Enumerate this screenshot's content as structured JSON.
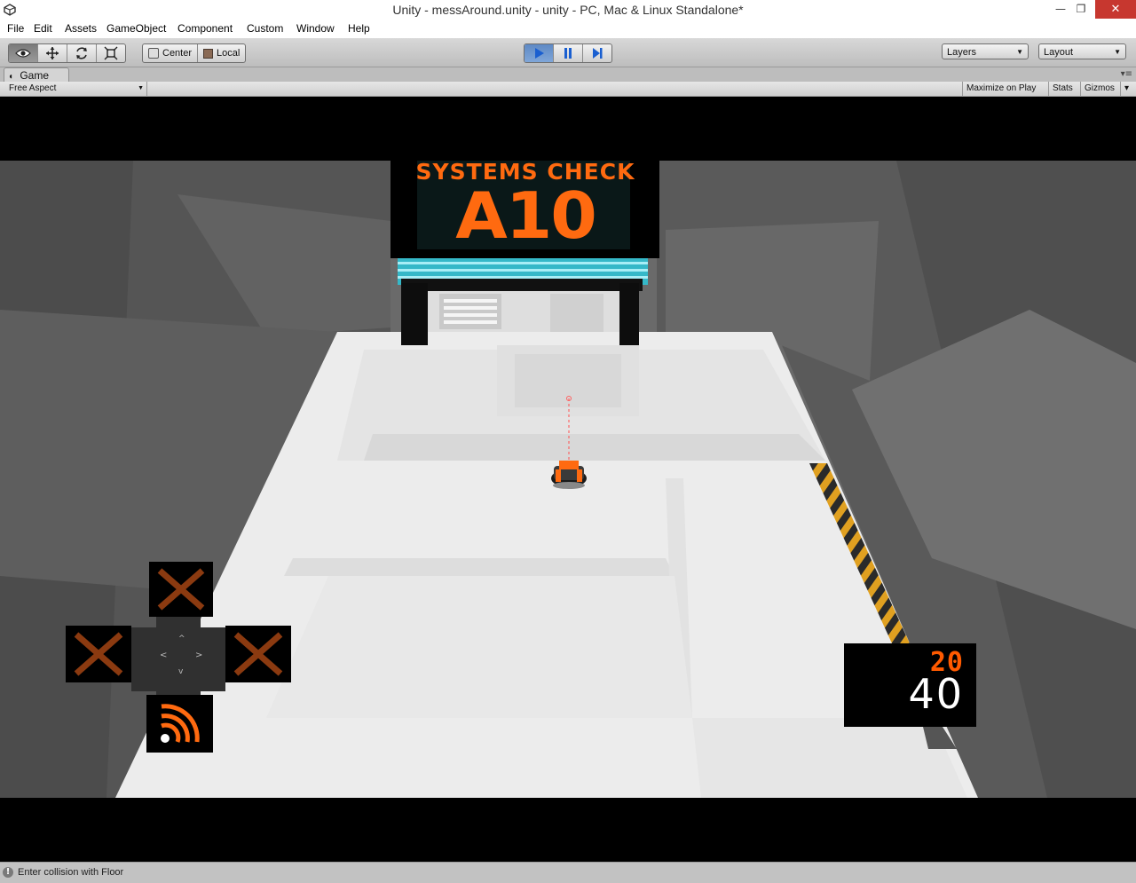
{
  "window": {
    "title": "Unity - messAround.unity - unity - PC, Mac & Linux Standalone*",
    "minimize_glyph": "—",
    "maximize_glyph": "❐",
    "close_glyph": "✕"
  },
  "menu": {
    "items": [
      "File",
      "Edit",
      "Assets",
      "GameObject",
      "Component",
      "Custom",
      "Window",
      "Help"
    ]
  },
  "toolbar": {
    "tools": [
      "view-tool",
      "move-tool",
      "rotate-tool",
      "scale-tool"
    ],
    "active_tool": "view-tool",
    "pivot_mode_label": "Center",
    "pivot_rotation_label": "Local",
    "layers_label": "Layers",
    "layout_label": "Layout",
    "play_state": "playing"
  },
  "game_tab": {
    "label": "Game",
    "aspect_label": "Free Aspect",
    "maximize_on_play_label": "Maximize on Play",
    "stats_label": "Stats",
    "gizmos_label": "Gizmos"
  },
  "game_view": {
    "sign_title": "SYSTEMS CHECK",
    "sign_code": "A10",
    "score_small": "20",
    "score_large": "40",
    "colors": {
      "accent_orange": "#ff6a10",
      "floor": "#ececec",
      "wall": "#5a5a5a",
      "teal": "#35b8c8",
      "hazard_yellow": "#e0a020"
    },
    "dpad_slot_icons": [
      "x-icon",
      "x-icon",
      "x-icon",
      "signal-icon"
    ]
  },
  "status": {
    "message": "Enter collision with Floor"
  }
}
